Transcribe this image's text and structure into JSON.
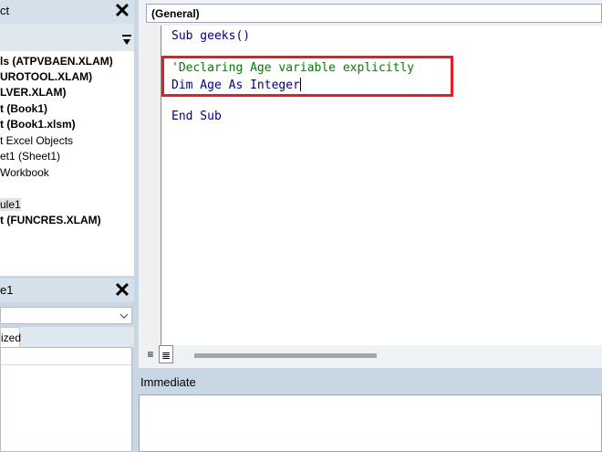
{
  "project": {
    "title": "ct",
    "tree": [
      {
        "label": "ls (ATPVBAEN.XLAM)",
        "bold": true,
        "selected": false
      },
      {
        "label": "UROTOOL.XLAM)",
        "bold": true,
        "selected": false
      },
      {
        "label": "LVER.XLAM)",
        "bold": true,
        "selected": false
      },
      {
        "label": "t (Book1)",
        "bold": true,
        "selected": false
      },
      {
        "label": "t (Book1.xlsm)",
        "bold": true,
        "selected": false
      },
      {
        "label": "t Excel Objects",
        "bold": false,
        "selected": false
      },
      {
        "label": "et1 (Sheet1)",
        "bold": false,
        "selected": false
      },
      {
        "label": "Workbook",
        "bold": false,
        "selected": false
      },
      {
        "label": "",
        "bold": false,
        "selected": false
      },
      {
        "label": "ule1",
        "bold": false,
        "selected": true
      },
      {
        "label": "t (FUNCRES.XLAM)",
        "bold": true,
        "selected": false
      }
    ]
  },
  "properties": {
    "title": "e1",
    "tab_label": "ized"
  },
  "code": {
    "procedure_dropdown": "(General)",
    "lines": {
      "sub_keyword": "Sub",
      "sub_name": " geeks()",
      "comment": "'Declaring Age variable explicitly",
      "dim_kw": "Dim",
      "dim_name": " Age ",
      "as_kw": "As",
      "space": " ",
      "type_kw": "Integer",
      "end_kw": "End Sub"
    },
    "highlight_color": "#e81c24"
  },
  "immediate": {
    "title": "Immediate"
  }
}
